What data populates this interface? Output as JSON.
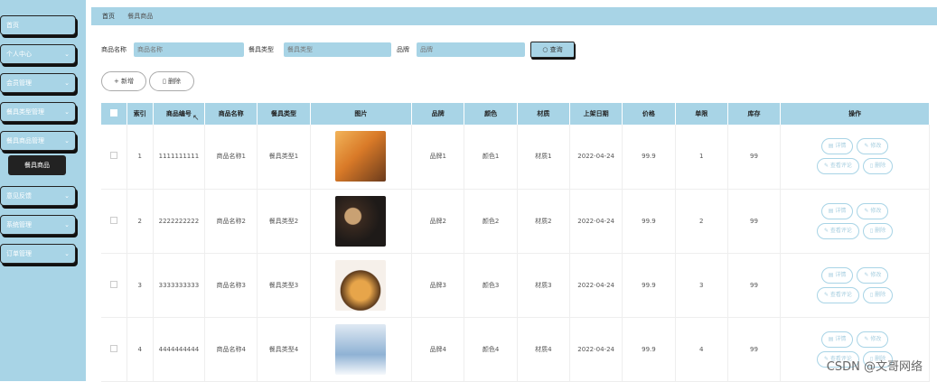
{
  "sidebar": {
    "items": [
      {
        "label": "首页",
        "has_chevron": false
      },
      {
        "label": "个人中心",
        "has_chevron": true
      },
      {
        "label": "会员管理",
        "has_chevron": true
      },
      {
        "label": "餐具类型管理",
        "has_chevron": true
      },
      {
        "label": "餐具商品管理",
        "has_chevron": true
      },
      {
        "label": "意见反馈",
        "has_chevron": true
      },
      {
        "label": "系统管理",
        "has_chevron": true
      },
      {
        "label": "订单管理",
        "has_chevron": true
      }
    ],
    "active_sub": "餐具商品"
  },
  "breadcrumb": {
    "home": "首页",
    "current": "餐具商品"
  },
  "search": {
    "name_label": "商品名称",
    "name_placeholder": "商品名称",
    "type_label": "餐具类型",
    "type_placeholder": "餐具类型",
    "brand_label": "品牌",
    "brand_placeholder": "品牌",
    "button": "查询"
  },
  "actions": {
    "add": "新增",
    "delete": "删除"
  },
  "table": {
    "headers": [
      "索引",
      "商品编号",
      "商品名称",
      "餐具类型",
      "图片",
      "品牌",
      "颜色",
      "材质",
      "上架日期",
      "价格",
      "单限",
      "库存",
      "操作"
    ],
    "rows": [
      {
        "index": "1",
        "code": "1111111111",
        "name": "商品名称1",
        "type": "餐具类型1",
        "brand": "品牌1",
        "color": "颜色1",
        "material": "材质1",
        "date": "2022-04-24",
        "price": "99.9",
        "limit": "1",
        "stock": "99"
      },
      {
        "index": "2",
        "code": "2222222222",
        "name": "商品名称2",
        "type": "餐具类型2",
        "brand": "品牌2",
        "color": "颜色2",
        "material": "材质2",
        "date": "2022-04-24",
        "price": "99.9",
        "limit": "2",
        "stock": "99"
      },
      {
        "index": "3",
        "code": "3333333333",
        "name": "商品名称3",
        "type": "餐具类型3",
        "brand": "品牌3",
        "color": "颜色3",
        "material": "材质3",
        "date": "2022-04-24",
        "price": "99.9",
        "limit": "3",
        "stock": "99"
      },
      {
        "index": "4",
        "code": "4444444444",
        "name": "商品名称4",
        "type": "餐具类型4",
        "brand": "品牌4",
        "color": "颜色4",
        "material": "材质4",
        "date": "2022-04-24",
        "price": "99.9",
        "limit": "4",
        "stock": "99"
      }
    ],
    "op_labels": {
      "detail": "详情",
      "edit": "修改",
      "review": "查看评论",
      "delete": "删除"
    }
  },
  "watermark": "CSDN @文哥网络",
  "colors": {
    "accent": "#a8d4e6",
    "dark": "#222222"
  }
}
